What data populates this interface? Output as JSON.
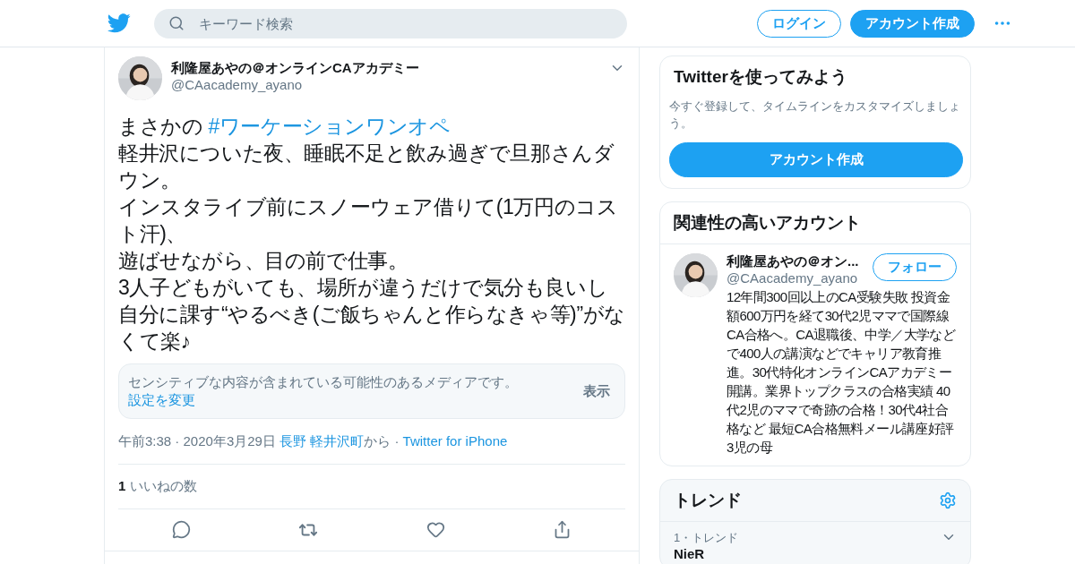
{
  "header": {
    "search": {
      "placeholder": "キーワード検索"
    },
    "login": "ログイン",
    "signup": "アカウント作成"
  },
  "tweet": {
    "author": {
      "name": "利隆屋あやの＠オンラインCAアカデミー",
      "handle": "@CAacademy_ayano"
    },
    "text_start": "まさかの ",
    "hashtag": "#ワーケーションワンオペ",
    "text_lines": [
      "軽井沢についた夜、睡眠不足と飲み過ぎで旦那さんダウン。",
      "インスタライブ前にスノーウェア借りて(1万円のコスト汗)、",
      "遊ばせながら、目の前で仕事。",
      "3人子どもがいても、場所が違うだけで気分も良いし自分に課す“やるべき(ご飯ちゃんと作らなきゃ等)”がなくて楽♪"
    ],
    "sensitive": {
      "message": "センシティブな内容が含まれている可能性のあるメディアです。",
      "link": "設定を変更",
      "button": "表示"
    },
    "meta": {
      "time": "午前3:38 · 2020年3月29日 ",
      "place": "長野 軽井沢町",
      "from": "から · ",
      "source": "Twitter for iPhone"
    },
    "likes": "**1** いいねの数"
  },
  "sidebar": {
    "join": {
      "title": "Twitterを使ってみよう",
      "text": "今すぐ登録して、タイムラインをカスタマイズしましょう。",
      "button": "アカウント作成"
    },
    "related": {
      "title": "関連性の高いアカウント",
      "accounts": [
        {
          "name": "利隆屋あやの＠オン...",
          "handle": "@CAacademy_ayano",
          "follow": "フォロー",
          "bio": "12年間300回以上のCA受験失敗 投資金額600万円を経て30代2児ママで国際線CA合格へ。CA退職後、中学／大学などで400人の講演などでキャリア教育推進。30代特化オンラインCAアカデミー開講。業界トップクラスの合格実績 40代2児のママで奇跡の合格！30代4社合格など 最短CA合格無料メール講座好評　3児の母"
        }
      ]
    },
    "trends": {
      "title": "トレンド",
      "items": [
        {
          "context": "1・トレンド",
          "name": "NieR"
        }
      ]
    }
  }
}
